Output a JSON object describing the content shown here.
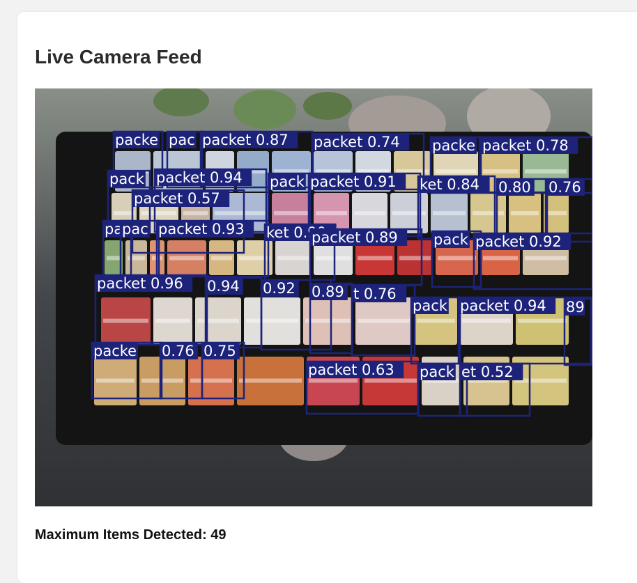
{
  "header": {
    "title": "Live Camera Feed"
  },
  "feed": {
    "box_color": "#1d237a",
    "detections": [
      {
        "label": "packe"
      },
      {
        "label": "pac"
      },
      {
        "label": "packet 0.87"
      },
      {
        "label": "packet 0.74"
      },
      {
        "label": "packe"
      },
      {
        "label": "packet 0.78"
      },
      {
        "label": "pack"
      },
      {
        "label": "packet 0.94"
      },
      {
        "label": "pack"
      },
      {
        "label": "packet 0.91"
      },
      {
        "label": "ket 0.84"
      },
      {
        "label": "0.80"
      },
      {
        "label": "0.76"
      },
      {
        "label": "packet 0.57"
      },
      {
        "label": "pa"
      },
      {
        "label": "pac"
      },
      {
        "label": "packet 0.93"
      },
      {
        "label": "ket 0.90"
      },
      {
        "label": "packet 0.89"
      },
      {
        "label": "pack"
      },
      {
        "label": "packet 0.92"
      },
      {
        "label": "packet 0.96"
      },
      {
        "label": "0.94"
      },
      {
        "label": "0.92"
      },
      {
        "label": "0.89"
      },
      {
        "label": "t 0.76"
      },
      {
        "label": "pack"
      },
      {
        "label": "packet 0.94"
      },
      {
        "label": "89"
      },
      {
        "label": "packe"
      },
      {
        "label": "0.76"
      },
      {
        "label": "0.75"
      },
      {
        "label": "packet 0.63"
      },
      {
        "label": "pack"
      },
      {
        "label": "et 0.52"
      }
    ]
  },
  "status": {
    "text": "Maximum Items Detected: 49"
  }
}
